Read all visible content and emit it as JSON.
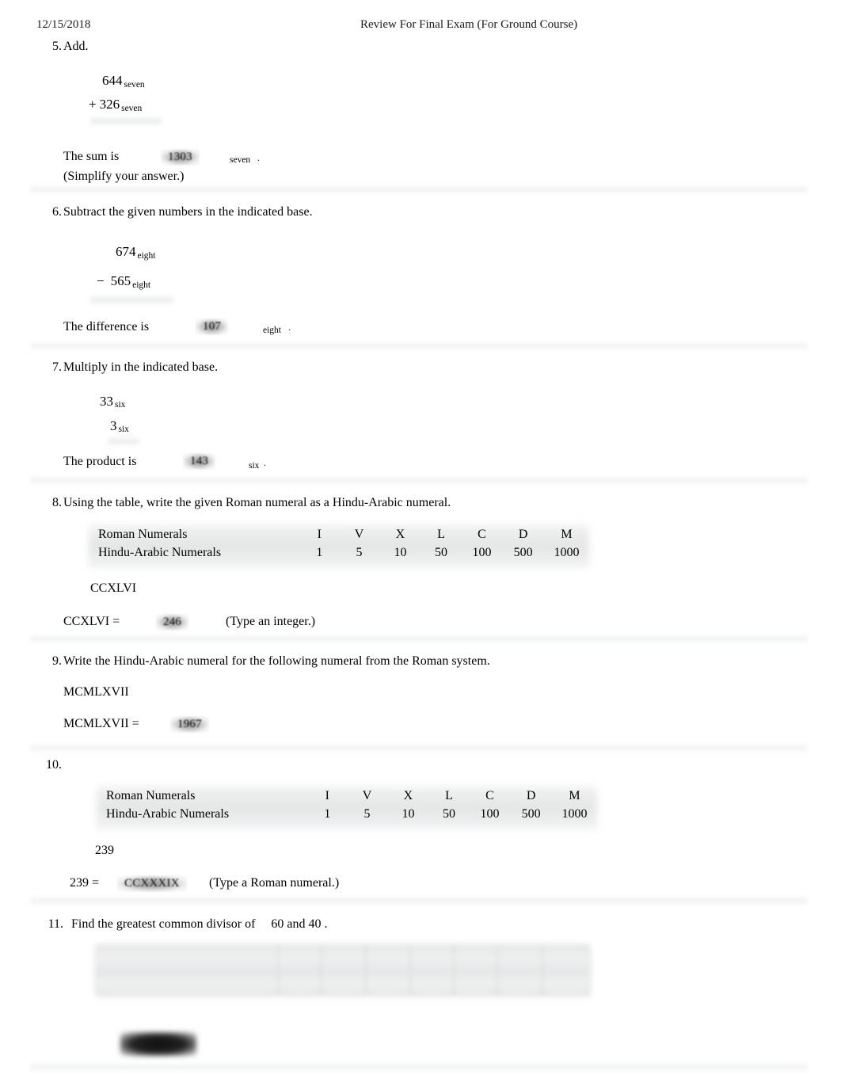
{
  "header": {
    "date": "12/15/2018",
    "title": "Review For Final Exam (For Ground Course)"
  },
  "problems": [
    {
      "number": "5.",
      "stem": "Add.",
      "operand1": "644",
      "operand1_base": "seven",
      "operator": "+",
      "operand2": "326",
      "operand2_base": "seven",
      "result_label": "The sum is",
      "answer": "1303",
      "answer_base": "seven",
      "terminator": ".",
      "note": "(Simplify your answer.)"
    },
    {
      "number": "6.",
      "stem": "Subtract the given numbers in the indicated base.",
      "operand1": "674",
      "operand1_base": "eight",
      "operator": "−",
      "operand2": "565",
      "operand2_base": "eight",
      "result_label": "The difference is",
      "answer": "107",
      "answer_base": "eight",
      "terminator": "."
    },
    {
      "number": "7.",
      "stem": "Multiply in the indicated base.",
      "operand1": "33",
      "operand1_base": "six",
      "operand2": "3",
      "operand2_base": "six",
      "result_label": "The product is",
      "answer": "143",
      "answer_base": "six",
      "terminator": "."
    },
    {
      "number": "8.",
      "stem": "Using the table, write the given Roman numeral as a Hindu-Arabic numeral.",
      "given": "CCXLVI",
      "equation_label": "CCXLVI =",
      "answer": "246",
      "note": "(Type an integer.)"
    },
    {
      "number": "9.",
      "stem": "Write the Hindu-Arabic numeral for the following numeral from the Roman system.",
      "given": "MCMLXVII",
      "equation_label": "MCMLXVII =",
      "answer": "1967"
    },
    {
      "number": "10.",
      "stem": "",
      "given": "239",
      "equation_label": "239 =",
      "answer": "CCXXXIX",
      "note": "(Type a Roman numeral.)"
    },
    {
      "number": "11.",
      "stem_parts": [
        "Find the greatest common divisor of",
        "60",
        "and",
        "40",
        "."
      ],
      "answer": "",
      "answer_redacted": true
    }
  ],
  "roman_table": {
    "row_labels": [
      "Roman Numerals",
      "Hindu-Arabic Numerals"
    ],
    "roman": [
      "I",
      "V",
      "X",
      "L",
      "C",
      "D",
      "M"
    ],
    "arabic": [
      "1",
      "5",
      "10",
      "50",
      "100",
      "500",
      "1000"
    ]
  }
}
